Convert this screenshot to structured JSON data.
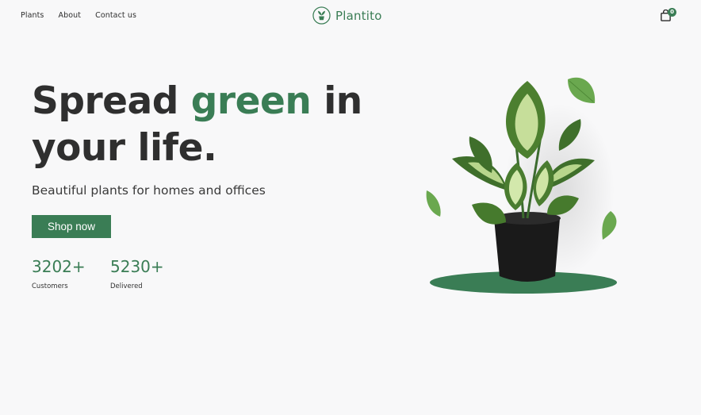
{
  "nav": {
    "links": [
      "Plants",
      "About",
      "Contact us"
    ]
  },
  "brand": {
    "name": "Plantito",
    "icon": "plant-pot-icon"
  },
  "cart": {
    "icon": "shopping-bag-icon",
    "count": "0"
  },
  "hero": {
    "title_part1": "Spread ",
    "title_accent": "green",
    "title_part2": " in your life.",
    "subtitle": "Beautiful plants for homes and offices",
    "cta_label": "Shop now"
  },
  "stats": [
    {
      "value": "3202+",
      "label": "Customers"
    },
    {
      "value": "5230+",
      "label": "Delivered"
    }
  ],
  "colors": {
    "accent": "#3a7d55",
    "background": "#f8f8f9",
    "text": "#2f2f2f"
  }
}
